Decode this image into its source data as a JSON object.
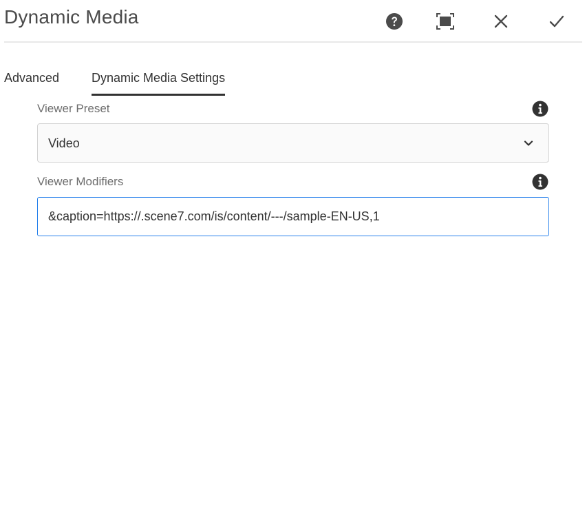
{
  "dialog": {
    "title": "Dynamic Media",
    "actions": {
      "help": "help-icon",
      "fullscreen": "fullscreen-icon",
      "close": "close-icon",
      "done": "checkmark-icon"
    }
  },
  "tabs": [
    {
      "label": "Advanced",
      "selected": false
    },
    {
      "label": "Dynamic Media Settings",
      "selected": true
    }
  ],
  "fields": {
    "viewer_preset": {
      "label": "Viewer Preset",
      "value": "Video",
      "icon": "chevron-down-icon",
      "info_icon": "info-icon"
    },
    "viewer_modifiers": {
      "label": "Viewer Modifiers",
      "value": "&caption=https://.scene7.com/is/content/---/sample-EN-US,1",
      "info_icon": "info-icon"
    }
  },
  "colors": {
    "text": "#323232",
    "label": "#6e6e6e",
    "focus_border": "#2680eb",
    "divider": "#e8e8e8"
  }
}
